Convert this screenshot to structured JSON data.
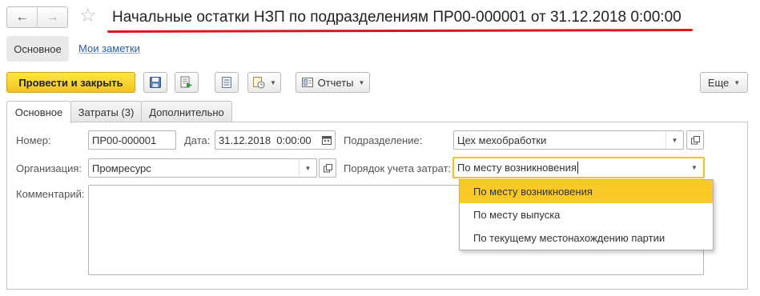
{
  "header": {
    "back_icon": "←",
    "forward_icon": "→",
    "star_icon": "☆",
    "title": "Начальные остатки НЗП по подразделениям ПР00-000001 от 31.12.2018 0:00:00"
  },
  "sections": {
    "main": "Основное",
    "notes": "Мои заметки"
  },
  "toolbar": {
    "post_close": "Провести и закрыть",
    "reports": "Отчеты",
    "more": "Еще"
  },
  "tabs": [
    {
      "label": "Основное"
    },
    {
      "label": "Затраты (3)"
    },
    {
      "label": "Дополнительно"
    }
  ],
  "form": {
    "number_label": "Номер:",
    "number_value": "ПР00-000001",
    "date_label": "Дата:",
    "date_value": "31.12.2018  0:00:00",
    "department_label": "Подразделение:",
    "department_value": "Цех мехобработки",
    "organization_label": "Организация:",
    "organization_value": "Промресурс",
    "cost_order_label": "Порядок учета затрат:",
    "cost_order_value": "По месту возникновения",
    "comment_label": "Комментарий:",
    "comment_value": ""
  },
  "cost_order_options": [
    "По месту возникновения",
    "По месту выпуска",
    "По текущему местонахождению партии"
  ],
  "colors": {
    "primary_button": "#f3c41b",
    "selected_option": "#f9c928",
    "title_underline": "#e01515",
    "link": "#2a5ca8"
  }
}
